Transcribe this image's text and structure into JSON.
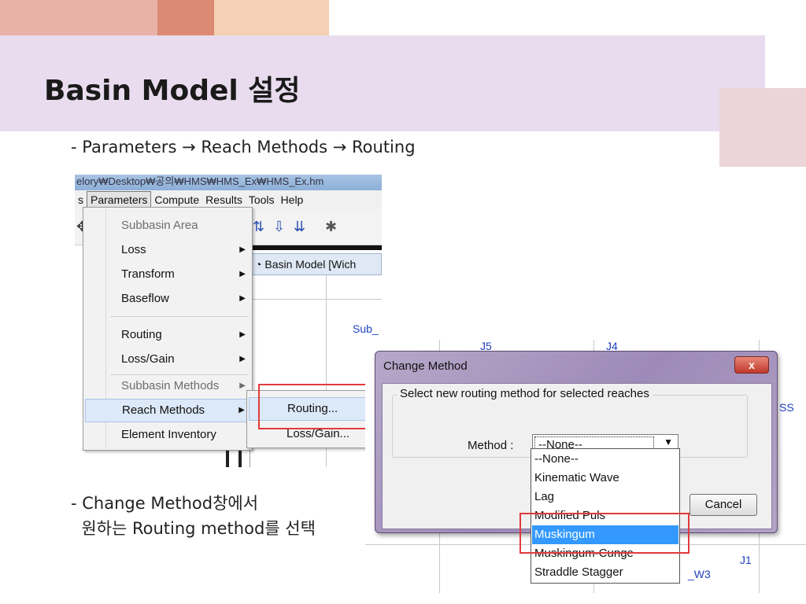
{
  "slide": {
    "title": "Basin Model 설정",
    "step1": "- Parameters → Reach Methods → Routing",
    "step2": "- Change Method창에서\n  원하는 Routing method를 선택"
  },
  "hms_window": {
    "title_path": "elory₩Desktop₩공의₩HMS₩HMS_Ex₩HMS_Ex.hm",
    "menubar": [
      "s",
      "Parameters",
      "Compute",
      "Results",
      "Tools",
      "Help"
    ],
    "doc_tab": "Basin Model [Wich",
    "map_label": "Sub_",
    "parameters_menu": [
      {
        "label": "Subbasin Area",
        "disabled": true,
        "arrow": false
      },
      {
        "label": "Loss",
        "disabled": false,
        "arrow": true
      },
      {
        "label": "Transform",
        "disabled": false,
        "arrow": true
      },
      {
        "label": "Baseflow",
        "disabled": false,
        "arrow": true
      },
      {
        "label": "Routing",
        "disabled": false,
        "arrow": true
      },
      {
        "label": "Loss/Gain",
        "disabled": false,
        "arrow": true
      },
      {
        "label": "Subbasin Methods",
        "disabled": true,
        "arrow": true
      },
      {
        "label": "Reach Methods",
        "disabled": false,
        "arrow": true,
        "highlighted": true
      },
      {
        "label": "Element Inventory",
        "disabled": false,
        "arrow": false
      }
    ],
    "reach_submenu": [
      {
        "label": "Routing...",
        "highlighted": true
      },
      {
        "label": "Loss/Gain..."
      }
    ]
  },
  "change_method_dialog": {
    "title": "Change Method",
    "close_label": "x",
    "group_label": "Select new routing method for selected reaches",
    "method_label": "Method :",
    "selected_value": "--None--",
    "cancel_label": "Cancel",
    "options": [
      "--None--",
      "Kinematic Wave",
      "Lag",
      "Modified Puls",
      "Muskingum",
      "Muskingum-Cunge",
      "Straddle Stagger"
    ],
    "highlighted_option": "Muskingum",
    "map_labels": [
      "J5",
      "J4",
      "SS",
      "J1",
      "_W3"
    ]
  }
}
